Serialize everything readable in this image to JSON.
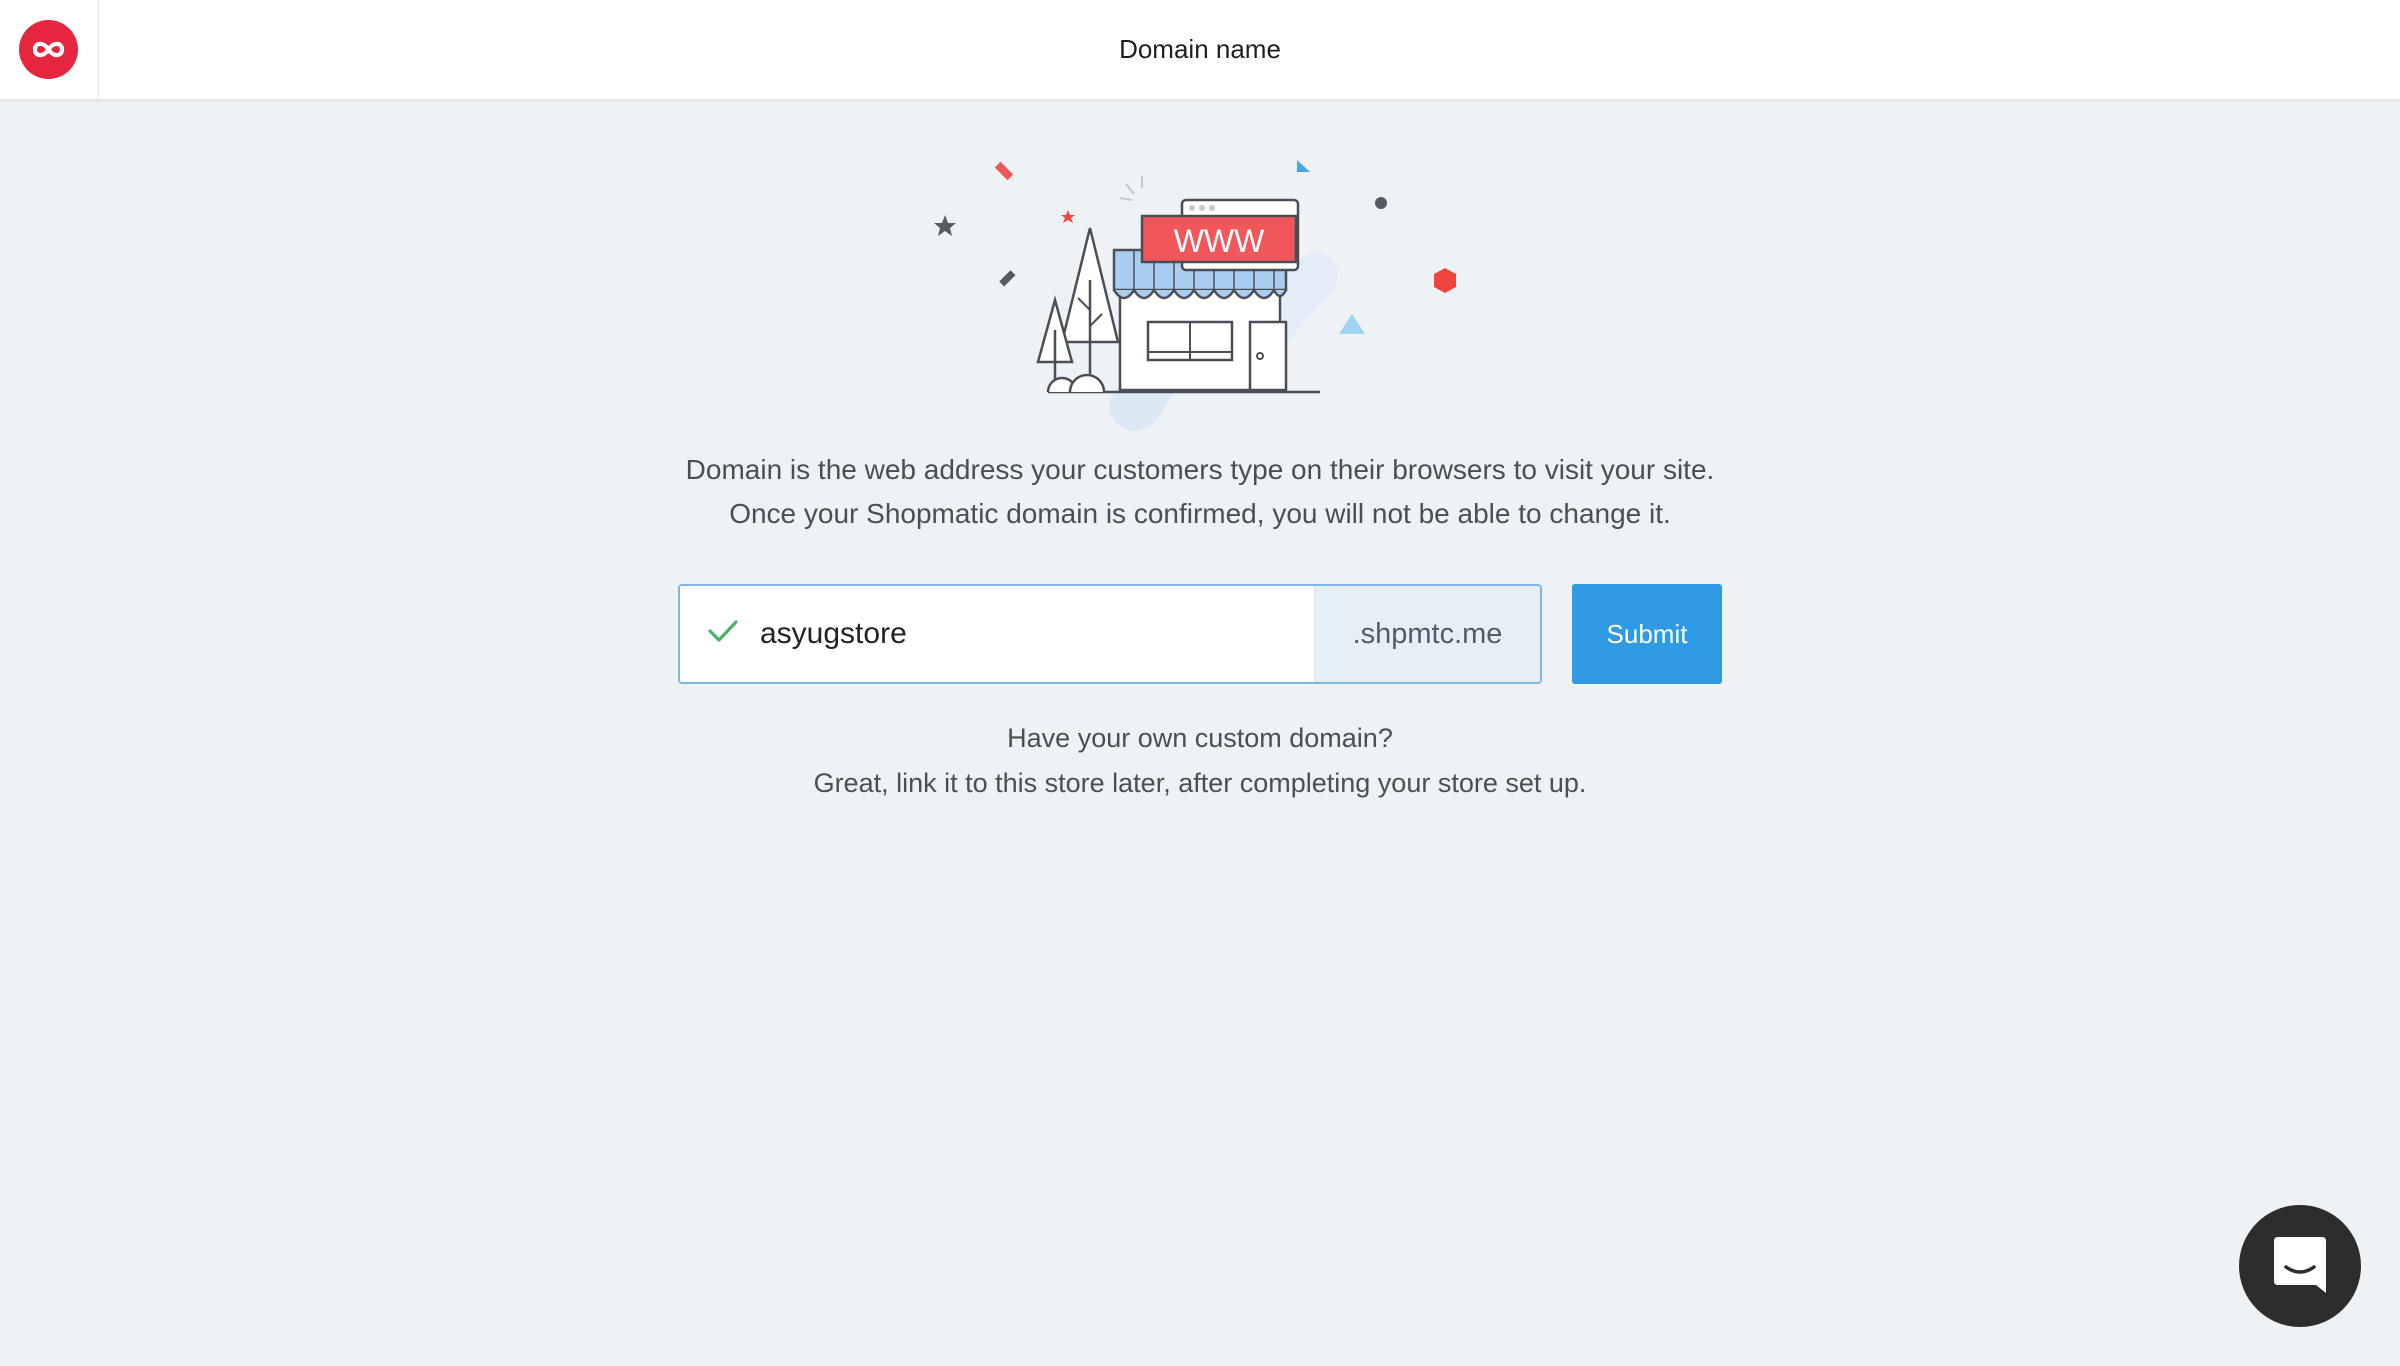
{
  "header": {
    "title": "Domain name",
    "logo_icon": "infinity-icon",
    "logo_color": "#e5263e"
  },
  "illustration": {
    "sign_text": "WWW",
    "icon": "storefront-illustration"
  },
  "intro": {
    "line1": "Domain is the web address your customers type on their browsers to visit your site.",
    "line2": "Once your Shopmatic domain is confirmed, you will not be able to change it."
  },
  "domain_form": {
    "value": "asyugstore",
    "suffix": ".shpmtc.me",
    "status_icon": "check-icon",
    "status_color": "#4cae6b",
    "submit_label": "Submit",
    "submit_color": "#2d9ae3"
  },
  "custom_domain": {
    "line1": "Have your own custom domain?",
    "line2": "Great, link it to this store later, after completing your store set up."
  },
  "chat": {
    "icon": "chat-icon"
  }
}
